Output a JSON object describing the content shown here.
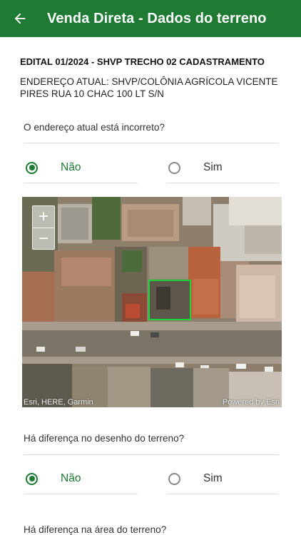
{
  "header": {
    "title": "Venda Direta - Dados do terreno",
    "back_icon": "arrow-left-icon",
    "background_color": "#1f7a34"
  },
  "edital": "EDITAL 01/2024 - SHVP TRECHO 02 CADASTRAMENTO",
  "address": "ENDEREÇO ATUAL: SHVP/COLÔNIA AGRÍCOLA VICENTE PIRES RUA 10 CHAC 100 LT S/N",
  "questions": [
    {
      "text": "O endereço atual está incorreto?",
      "options": [
        "Não",
        "Sim"
      ],
      "selected": "Não"
    },
    {
      "text": "Há diferença no desenho do terreno?",
      "options": [
        "Não",
        "Sim"
      ],
      "selected": "Não"
    },
    {
      "text": "Há diferença na área do terreno?"
    }
  ],
  "map": {
    "zoom_in": "+",
    "zoom_out": "−",
    "attribution_left": "Esri, HERE, Garmin",
    "attribution_right": "Powered by Esri",
    "parcel_outline_color": "#19d43a"
  }
}
